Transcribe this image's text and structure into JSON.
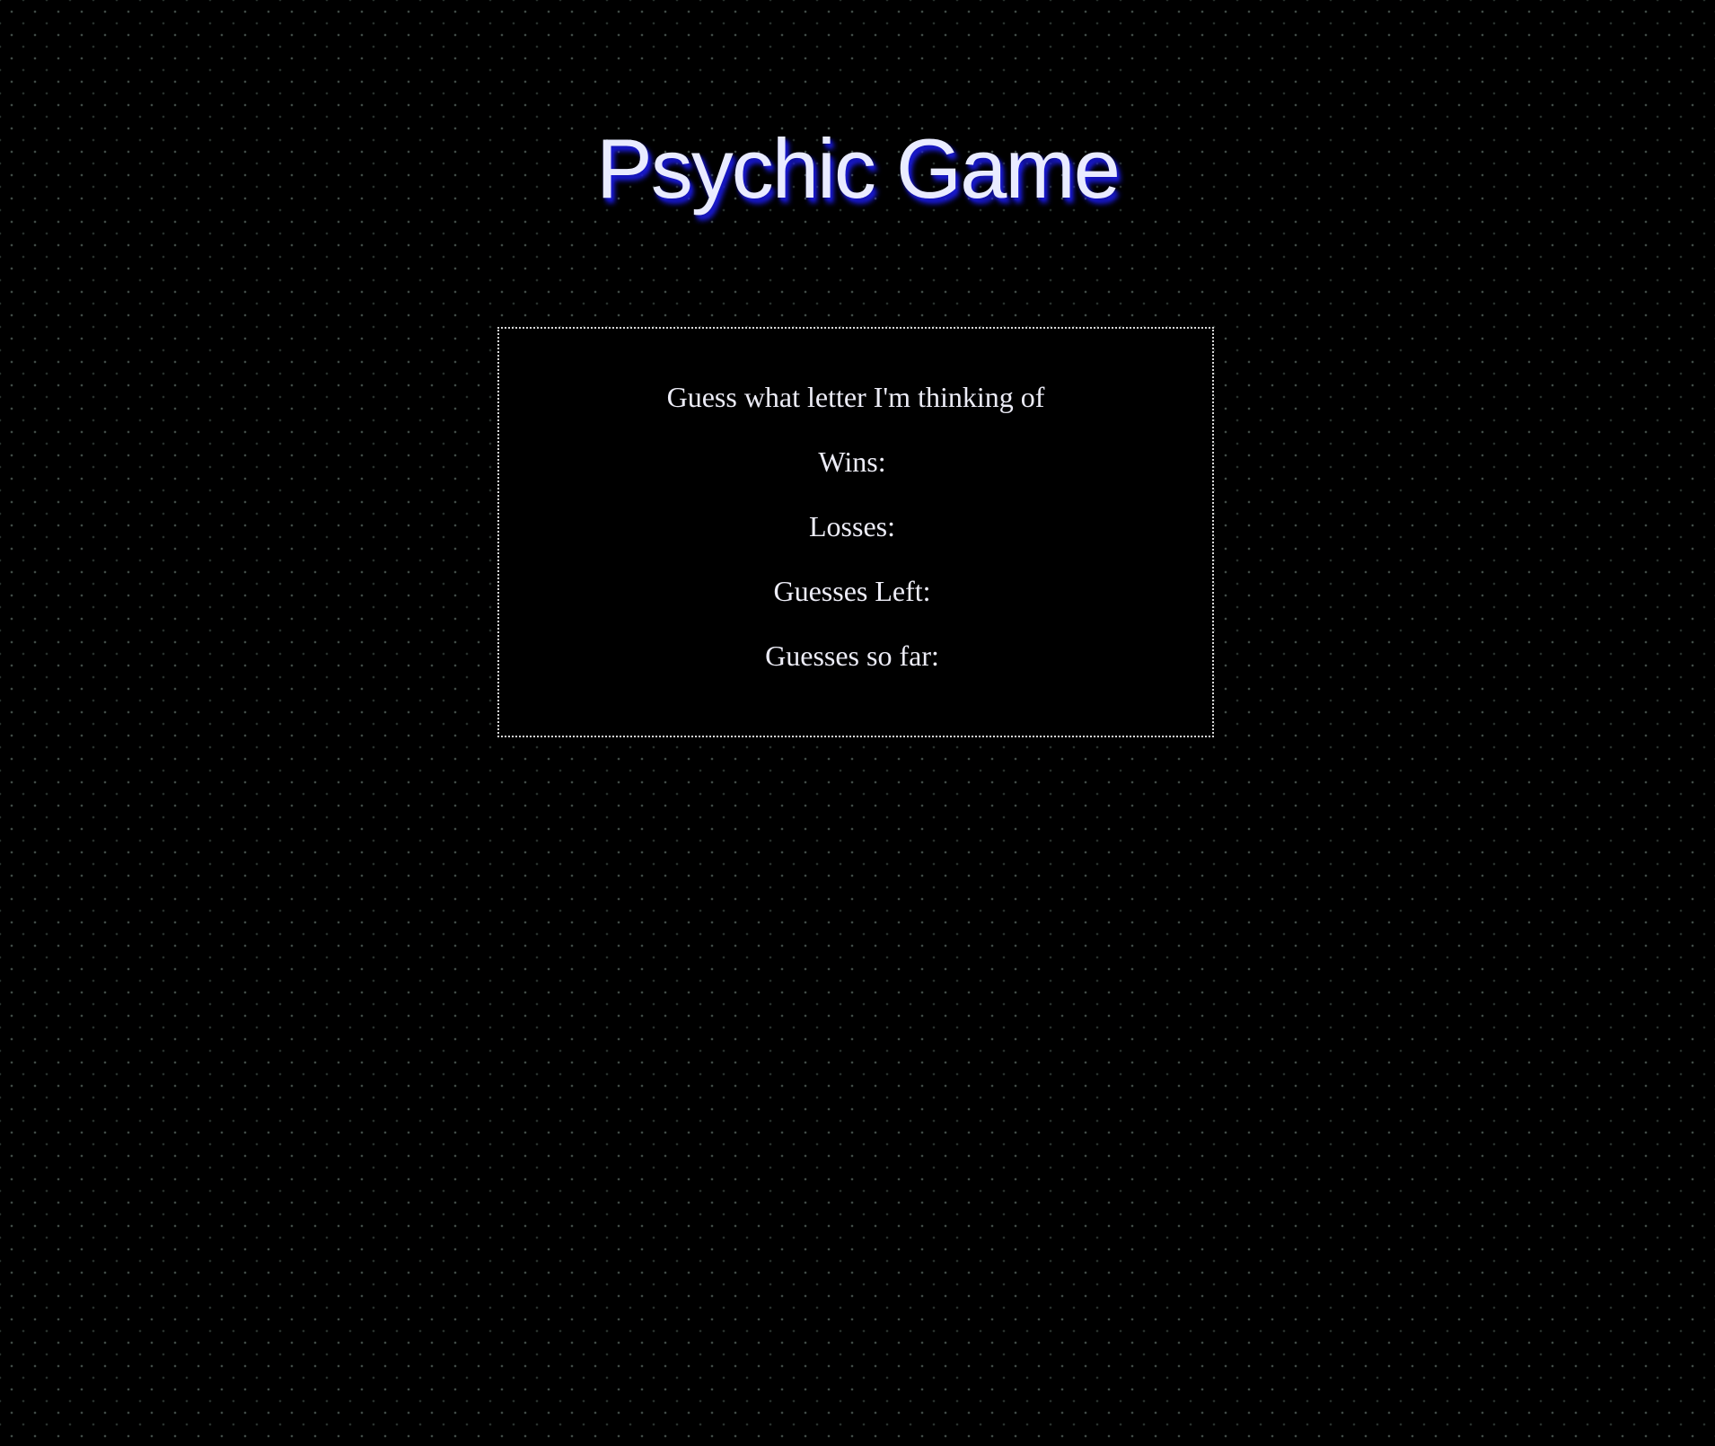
{
  "header": {
    "title": "Psychic Game"
  },
  "game": {
    "prompt": "Guess what letter I'm thinking of",
    "wins_label": "Wins:",
    "wins_value": "",
    "losses_label": "Losses:",
    "losses_value": "",
    "guesses_left_label": "Guesses Left:",
    "guesses_left_value": "",
    "guesses_so_far_label": "Guesses so far:",
    "guesses_so_far_value": ""
  },
  "colors": {
    "background": "#000000",
    "text": "#ececf6",
    "title_glow": "#1b1bd8",
    "box_border": "#d8d8d8"
  }
}
